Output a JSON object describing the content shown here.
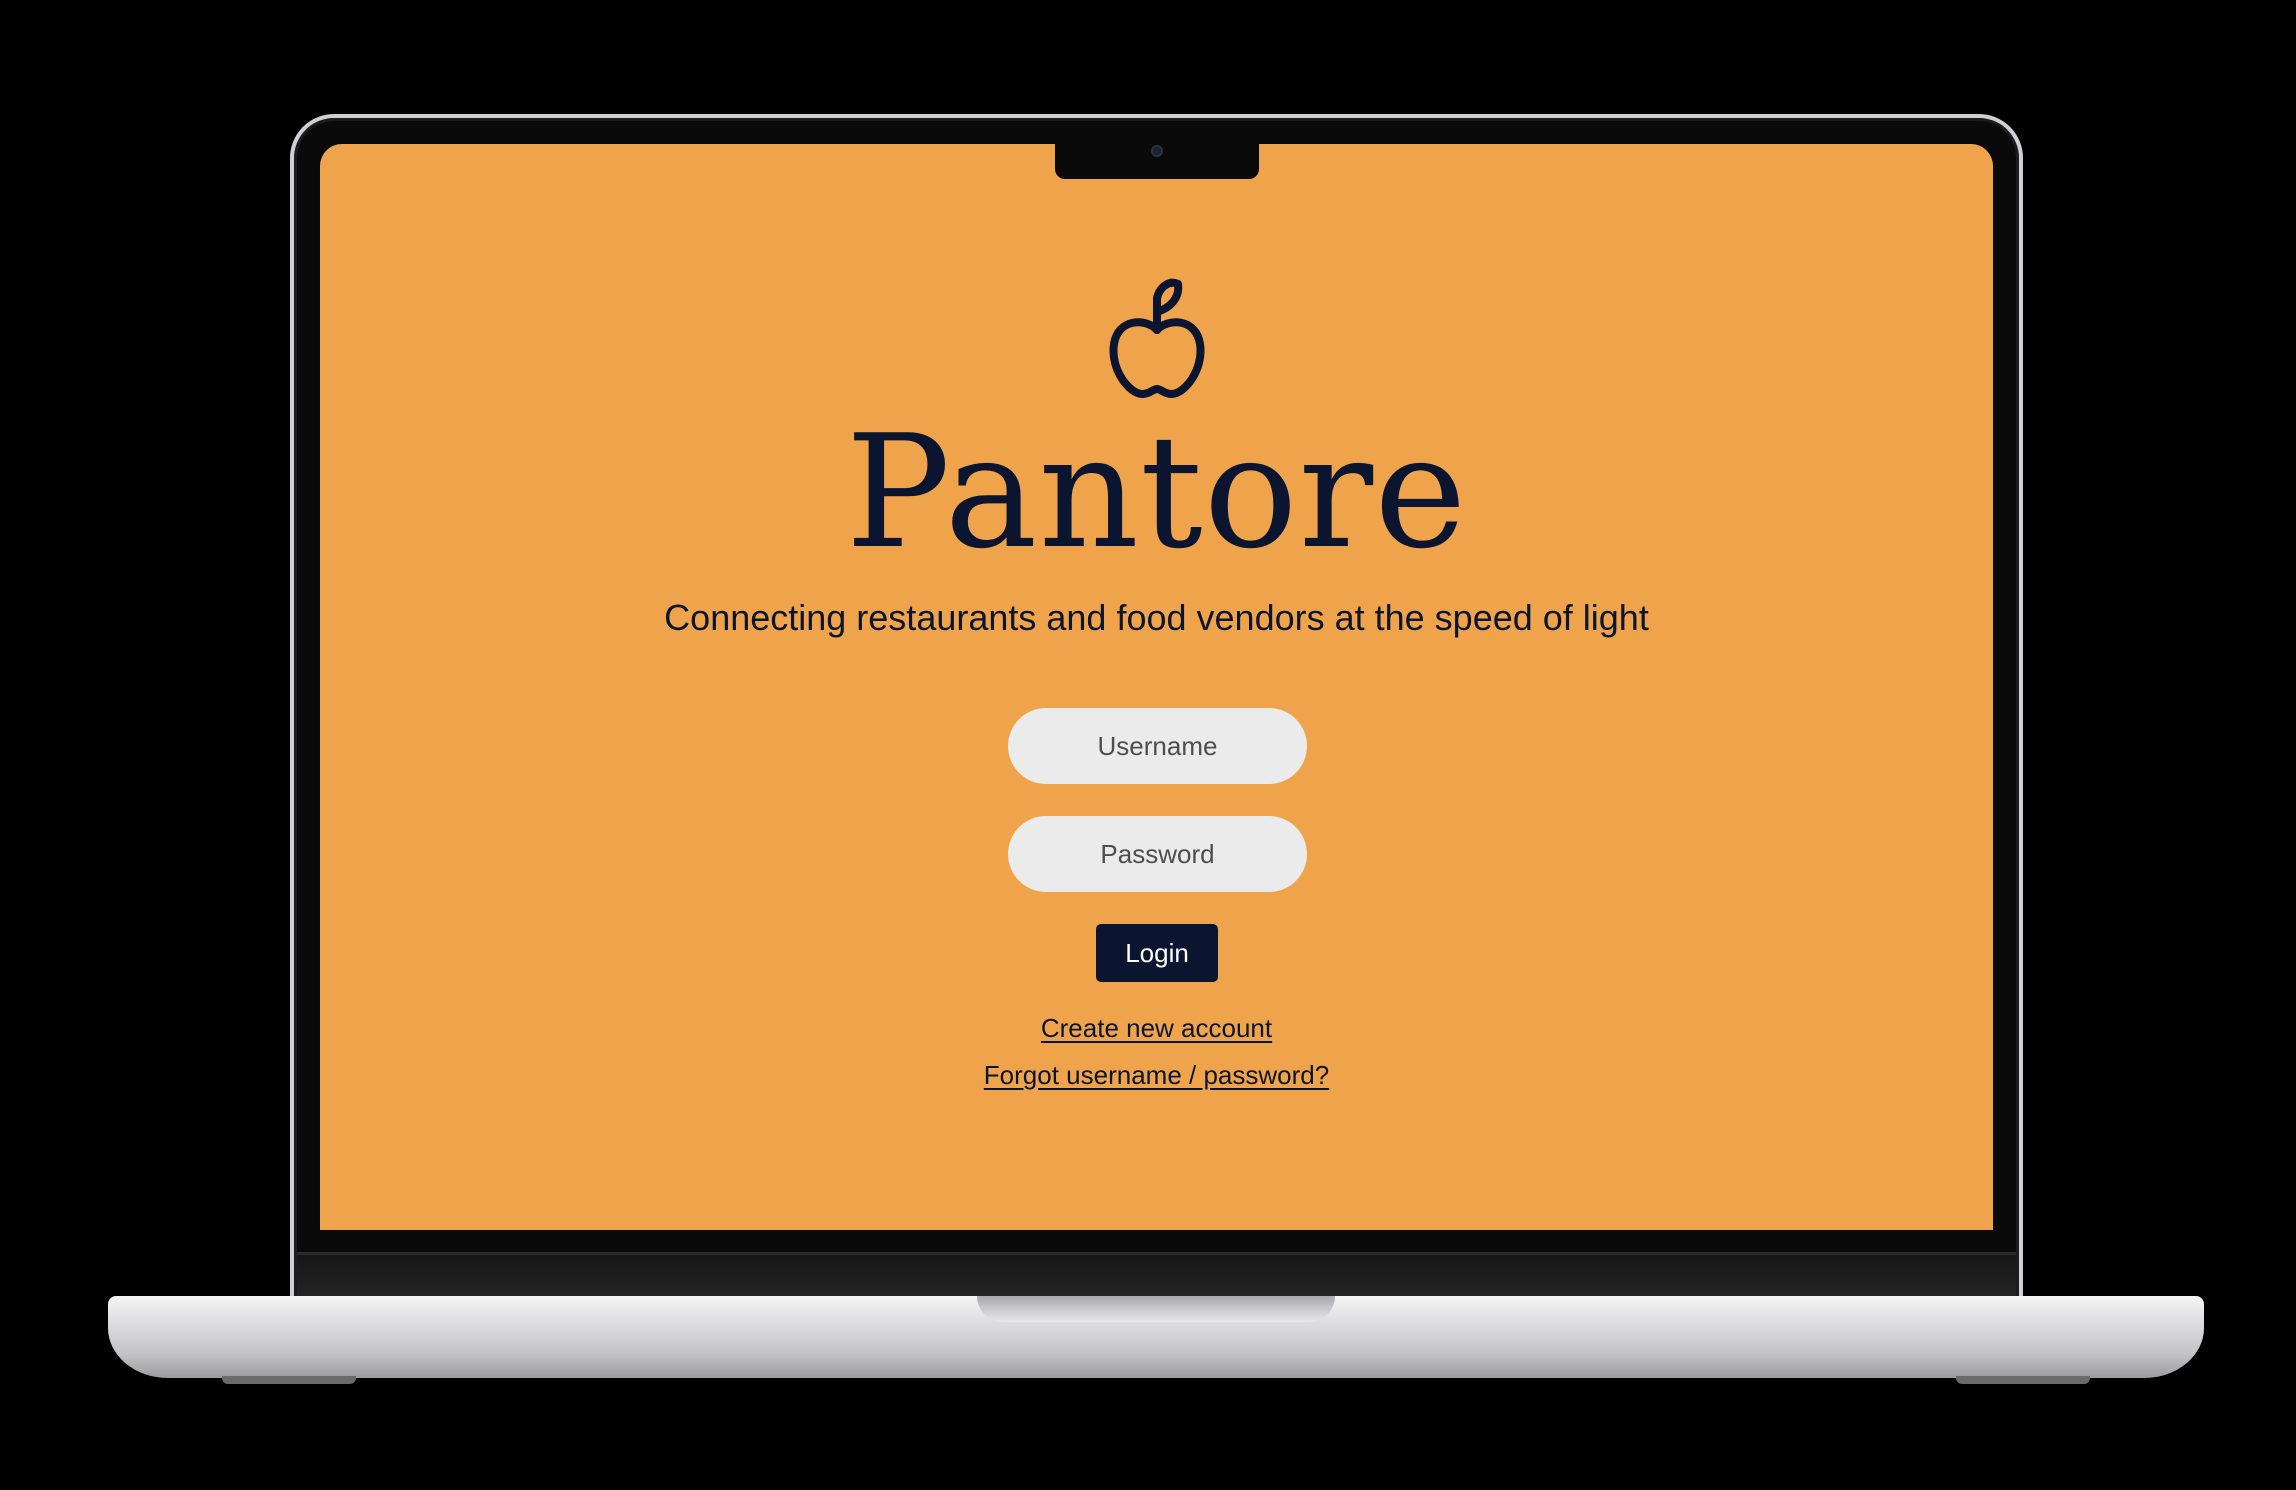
{
  "app": {
    "title": "Pantore",
    "tagline": "Connecting restaurants and food vendors at the speed of light",
    "logo_icon": "apple-icon"
  },
  "form": {
    "username_placeholder": "Username",
    "username_value": "",
    "password_placeholder": "Password",
    "password_value": "",
    "login_label": "Login",
    "create_account_label": "Create new account",
    "forgot_label": "Forgot username / password?"
  },
  "colors": {
    "background": "#efa44b",
    "text": "#0b1530",
    "field_background": "#ebebeb",
    "button_background": "#0b1530",
    "button_text": "#ffffff"
  }
}
